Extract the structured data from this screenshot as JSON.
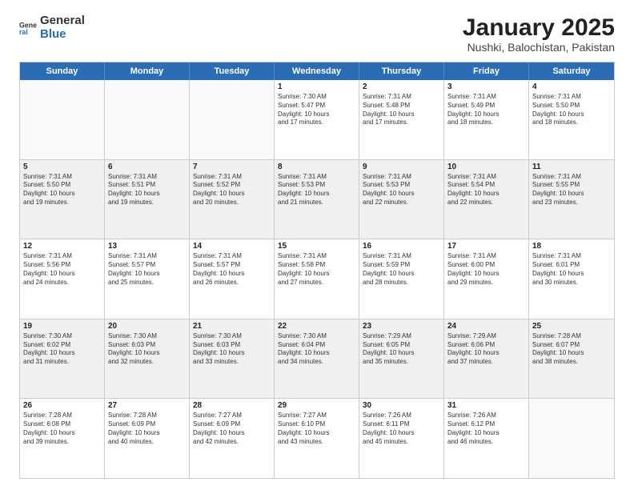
{
  "logo": {
    "general": "General",
    "blue": "Blue"
  },
  "title": "January 2025",
  "subtitle": "Nushki, Balochistan, Pakistan",
  "days": [
    "Sunday",
    "Monday",
    "Tuesday",
    "Wednesday",
    "Thursday",
    "Friday",
    "Saturday"
  ],
  "rows": [
    [
      {
        "day": "",
        "info": "",
        "empty": true
      },
      {
        "day": "",
        "info": "",
        "empty": true
      },
      {
        "day": "",
        "info": "",
        "empty": true
      },
      {
        "day": "1",
        "info": "Sunrise: 7:30 AM\nSunset: 5:47 PM\nDaylight: 10 hours\nand 17 minutes."
      },
      {
        "day": "2",
        "info": "Sunrise: 7:31 AM\nSunset: 5:48 PM\nDaylight: 10 hours\nand 17 minutes."
      },
      {
        "day": "3",
        "info": "Sunrise: 7:31 AM\nSunset: 5:49 PM\nDaylight: 10 hours\nand 18 minutes."
      },
      {
        "day": "4",
        "info": "Sunrise: 7:31 AM\nSunset: 5:50 PM\nDaylight: 10 hours\nand 18 minutes."
      }
    ],
    [
      {
        "day": "5",
        "info": "Sunrise: 7:31 AM\nSunset: 5:50 PM\nDaylight: 10 hours\nand 19 minutes.",
        "shaded": true
      },
      {
        "day": "6",
        "info": "Sunrise: 7:31 AM\nSunset: 5:51 PM\nDaylight: 10 hours\nand 19 minutes.",
        "shaded": true
      },
      {
        "day": "7",
        "info": "Sunrise: 7:31 AM\nSunset: 5:52 PM\nDaylight: 10 hours\nand 20 minutes.",
        "shaded": true
      },
      {
        "day": "8",
        "info": "Sunrise: 7:31 AM\nSunset: 5:53 PM\nDaylight: 10 hours\nand 21 minutes.",
        "shaded": true
      },
      {
        "day": "9",
        "info": "Sunrise: 7:31 AM\nSunset: 5:53 PM\nDaylight: 10 hours\nand 22 minutes.",
        "shaded": true
      },
      {
        "day": "10",
        "info": "Sunrise: 7:31 AM\nSunset: 5:54 PM\nDaylight: 10 hours\nand 22 minutes.",
        "shaded": true
      },
      {
        "day": "11",
        "info": "Sunrise: 7:31 AM\nSunset: 5:55 PM\nDaylight: 10 hours\nand 23 minutes.",
        "shaded": true
      }
    ],
    [
      {
        "day": "12",
        "info": "Sunrise: 7:31 AM\nSunset: 5:56 PM\nDaylight: 10 hours\nand 24 minutes."
      },
      {
        "day": "13",
        "info": "Sunrise: 7:31 AM\nSunset: 5:57 PM\nDaylight: 10 hours\nand 25 minutes."
      },
      {
        "day": "14",
        "info": "Sunrise: 7:31 AM\nSunset: 5:57 PM\nDaylight: 10 hours\nand 26 minutes."
      },
      {
        "day": "15",
        "info": "Sunrise: 7:31 AM\nSunset: 5:58 PM\nDaylight: 10 hours\nand 27 minutes."
      },
      {
        "day": "16",
        "info": "Sunrise: 7:31 AM\nSunset: 5:59 PM\nDaylight: 10 hours\nand 28 minutes."
      },
      {
        "day": "17",
        "info": "Sunrise: 7:31 AM\nSunset: 6:00 PM\nDaylight: 10 hours\nand 29 minutes."
      },
      {
        "day": "18",
        "info": "Sunrise: 7:31 AM\nSunset: 6:01 PM\nDaylight: 10 hours\nand 30 minutes."
      }
    ],
    [
      {
        "day": "19",
        "info": "Sunrise: 7:30 AM\nSunset: 6:02 PM\nDaylight: 10 hours\nand 31 minutes.",
        "shaded": true
      },
      {
        "day": "20",
        "info": "Sunrise: 7:30 AM\nSunset: 6:03 PM\nDaylight: 10 hours\nand 32 minutes.",
        "shaded": true
      },
      {
        "day": "21",
        "info": "Sunrise: 7:30 AM\nSunset: 6:03 PM\nDaylight: 10 hours\nand 33 minutes.",
        "shaded": true
      },
      {
        "day": "22",
        "info": "Sunrise: 7:30 AM\nSunset: 6:04 PM\nDaylight: 10 hours\nand 34 minutes.",
        "shaded": true
      },
      {
        "day": "23",
        "info": "Sunrise: 7:29 AM\nSunset: 6:05 PM\nDaylight: 10 hours\nand 35 minutes.",
        "shaded": true
      },
      {
        "day": "24",
        "info": "Sunrise: 7:29 AM\nSunset: 6:06 PM\nDaylight: 10 hours\nand 37 minutes.",
        "shaded": true
      },
      {
        "day": "25",
        "info": "Sunrise: 7:28 AM\nSunset: 6:07 PM\nDaylight: 10 hours\nand 38 minutes.",
        "shaded": true
      }
    ],
    [
      {
        "day": "26",
        "info": "Sunrise: 7:28 AM\nSunset: 6:08 PM\nDaylight: 10 hours\nand 39 minutes."
      },
      {
        "day": "27",
        "info": "Sunrise: 7:28 AM\nSunset: 6:09 PM\nDaylight: 10 hours\nand 40 minutes."
      },
      {
        "day": "28",
        "info": "Sunrise: 7:27 AM\nSunset: 6:09 PM\nDaylight: 10 hours\nand 42 minutes."
      },
      {
        "day": "29",
        "info": "Sunrise: 7:27 AM\nSunset: 6:10 PM\nDaylight: 10 hours\nand 43 minutes."
      },
      {
        "day": "30",
        "info": "Sunrise: 7:26 AM\nSunset: 6:11 PM\nDaylight: 10 hours\nand 45 minutes."
      },
      {
        "day": "31",
        "info": "Sunrise: 7:26 AM\nSunset: 6:12 PM\nDaylight: 10 hours\nand 46 minutes."
      },
      {
        "day": "",
        "info": "",
        "empty": true
      }
    ]
  ]
}
